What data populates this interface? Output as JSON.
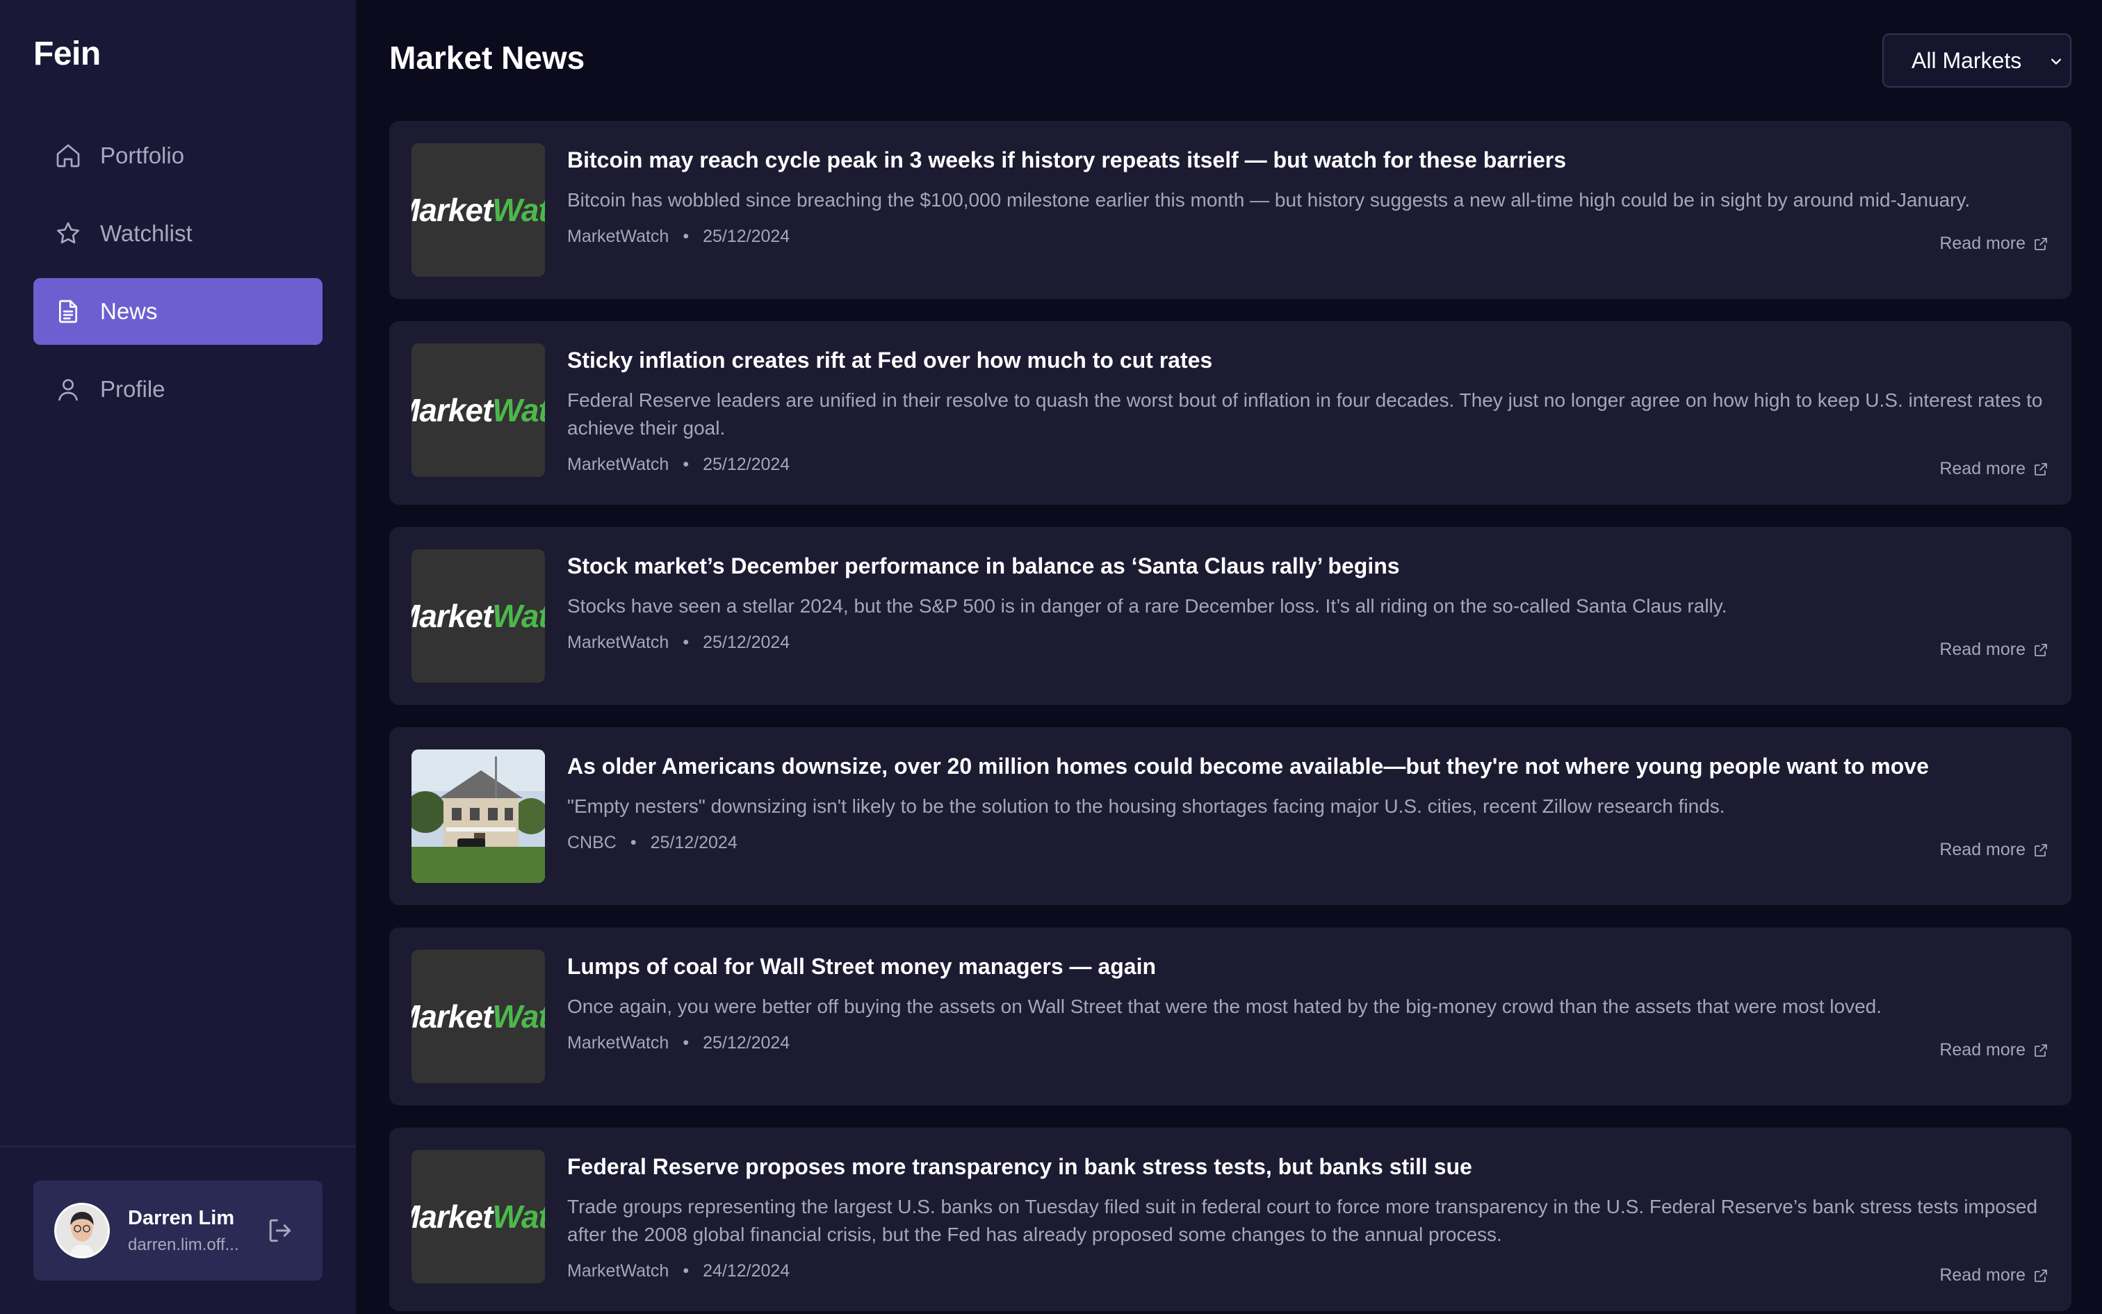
{
  "app": {
    "brand": "Fein"
  },
  "sidebar": {
    "items": [
      {
        "label": "Portfolio",
        "icon": "home-icon",
        "active": false
      },
      {
        "label": "Watchlist",
        "icon": "star-icon",
        "active": false
      },
      {
        "label": "News",
        "icon": "document-icon",
        "active": true
      },
      {
        "label": "Profile",
        "icon": "user-icon",
        "active": false
      }
    ],
    "user": {
      "name": "Darren Lim",
      "email": "darren.lim.off..."
    }
  },
  "header": {
    "title": "Market News",
    "market_filter": "All Markets"
  },
  "news": [
    {
      "title": "Bitcoin may reach cycle peak in 3 weeks if history repeats itself — but watch for these barriers",
      "description": "Bitcoin has wobbled since breaching the $100,000 milestone earlier this month — but history suggests a new all-time high could be in sight by around mid-January.",
      "source": "MarketWatch",
      "date": "25/12/2024",
      "read_more": "Read more",
      "thumb": "marketwatch-logo"
    },
    {
      "title": "Sticky inflation creates rift at Fed over how much to cut rates",
      "description": "Federal Reserve leaders are unified in their resolve to quash the worst bout of inflation in four decades. They just no longer agree on how high to keep U.S. interest rates to achieve their goal.",
      "source": "MarketWatch",
      "date": "25/12/2024",
      "read_more": "Read more",
      "thumb": "marketwatch-logo"
    },
    {
      "title": "Stock market’s December performance in balance as ‘Santa Claus rally’ begins",
      "description": "Stocks have seen a stellar 2024, but the S&P 500 is in danger of a rare December loss. It’s all riding on the so-called Santa Claus rally.",
      "source": "MarketWatch",
      "date": "25/12/2024",
      "read_more": "Read more",
      "thumb": "marketwatch-logo"
    },
    {
      "title": "As older Americans downsize, over 20 million homes could become available—but they're not where young people want to move",
      "description": "\"Empty nesters\" downsizing isn't likely to be the solution to the housing shortages facing major U.S. cities, recent Zillow research finds.",
      "source": "CNBC",
      "date": "25/12/2024",
      "read_more": "Read more",
      "thumb": "house-photo"
    },
    {
      "title": "Lumps of coal for Wall Street money managers — again",
      "description": "Once again, you were better off buying the assets on Wall Street that were the most hated by the big-money crowd than the assets that were most loved.",
      "source": "MarketWatch",
      "date": "25/12/2024",
      "read_more": "Read more",
      "thumb": "marketwatch-logo"
    },
    {
      "title": "Federal Reserve proposes more transparency in bank stress tests, but banks still sue",
      "description": "Trade groups representing the largest U.S. banks on Tuesday filed suit in federal court to force more transparency in the U.S. Federal Reserve’s bank stress tests imposed after the 2008 global financial crisis, but the Fed has already proposed some changes to the annual process.",
      "source": "MarketWatch",
      "date": "24/12/2024",
      "read_more": "Read more",
      "thumb": "marketwatch-logo"
    }
  ],
  "thumb_logo": {
    "part1": "Market",
    "part2": "Watch"
  },
  "colors": {
    "accent": "#6e5fd0",
    "sidebar_bg": "#191836",
    "page_bg": "#0c0b1d",
    "card_bg": "#1c1b32",
    "logo_green": "#4cb84c"
  }
}
